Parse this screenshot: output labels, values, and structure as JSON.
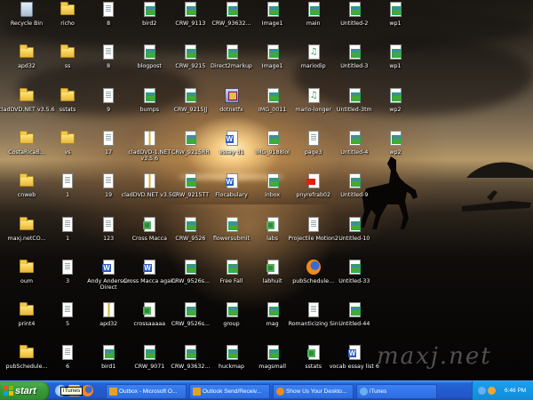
{
  "desktop": {
    "watermark": "maxj.net",
    "columns": [
      [
        {
          "label": "Recycle Bin",
          "icon": "recycle-bin-icon"
        },
        {
          "label": "apd32",
          "icon": "folder-icon"
        },
        {
          "label": "cladDVD.NET v3.5.6",
          "icon": "folder-icon"
        },
        {
          "label": "CostaRicaB...",
          "icon": "folder-icon"
        },
        {
          "label": "cnweb",
          "icon": "folder-icon"
        },
        {
          "label": "maxj.netCO...",
          "icon": "folder-icon"
        },
        {
          "label": "oum",
          "icon": "folder-icon"
        },
        {
          "label": "print4",
          "icon": "folder-icon"
        },
        {
          "label": "pubSchedule...",
          "icon": "folder-icon"
        }
      ],
      [
        {
          "label": "richo",
          "icon": "folder-icon"
        },
        {
          "label": "ss",
          "icon": "folder-icon"
        },
        {
          "label": "sstats",
          "icon": "folder-icon"
        },
        {
          "label": "vs",
          "icon": "folder-icon"
        },
        {
          "label": "1",
          "icon": "document-icon"
        },
        {
          "label": "1",
          "icon": "document-icon"
        },
        {
          "label": "3",
          "icon": "document-icon"
        },
        {
          "label": "5",
          "icon": "document-icon"
        },
        {
          "label": "6",
          "icon": "document-icon"
        }
      ],
      [
        {
          "label": "8",
          "icon": "document-icon"
        },
        {
          "label": "8",
          "icon": "document-icon"
        },
        {
          "label": "9",
          "icon": "document-icon"
        },
        {
          "label": "17",
          "icon": "document-icon"
        },
        {
          "label": "19",
          "icon": "document-icon"
        },
        {
          "label": "123",
          "icon": "document-icon"
        },
        {
          "label": "Andy Anderson Direct",
          "icon": "word-document-icon"
        },
        {
          "label": "apd32",
          "icon": "zip-archive-icon"
        },
        {
          "label": "bird1",
          "icon": "image-file-icon"
        }
      ],
      [
        {
          "label": "bird2",
          "icon": "image-file-icon"
        },
        {
          "label": "blogpost",
          "icon": "image-file-icon"
        },
        {
          "label": "bumps",
          "icon": "image-file-icon"
        },
        {
          "label": "cladDVD-1.NET v3.5.6",
          "icon": "zip-archive-icon"
        },
        {
          "label": "cladDVD.NET v3.5.6",
          "icon": "zip-archive-icon"
        },
        {
          "label": "Cross Macca",
          "icon": "excel-sheet-icon"
        },
        {
          "label": "Cross Macca again",
          "icon": "word-document-icon"
        },
        {
          "label": "crossaaaaa",
          "icon": "excel-sheet-icon"
        },
        {
          "label": "CRW_9071",
          "icon": "image-file-icon"
        }
      ],
      [
        {
          "label": "CRW_9113",
          "icon": "image-file-icon"
        },
        {
          "label": "CRW_9215",
          "icon": "image-file-icon"
        },
        {
          "label": "CRW_9215JJ",
          "icon": "image-file-icon"
        },
        {
          "label": "CRW_9215RR",
          "icon": "image-file-icon"
        },
        {
          "label": "CRW_9215TT",
          "icon": "image-file-icon"
        },
        {
          "label": "CRW_9526",
          "icon": "image-file-icon"
        },
        {
          "label": "CRW_9526s...",
          "icon": "image-file-icon"
        },
        {
          "label": "CRW_9526s...",
          "icon": "image-file-icon"
        },
        {
          "label": "CRW_93632...",
          "icon": "image-file-icon"
        }
      ],
      [
        {
          "label": "CRW_93632...",
          "icon": "image-file-icon"
        },
        {
          "label": "Direct2markup",
          "icon": "image-file-icon"
        },
        {
          "label": "dotnetfx",
          "icon": "installer-icon"
        },
        {
          "label": "essay d1",
          "icon": "word-document-icon"
        },
        {
          "label": "Flocabulary",
          "icon": "word-document-icon"
        },
        {
          "label": "flowersubmit",
          "icon": "image-file-icon"
        },
        {
          "label": "Free Fall",
          "icon": "image-file-icon"
        },
        {
          "label": "group",
          "icon": "image-file-icon"
        },
        {
          "label": "huckmap",
          "icon": "image-file-icon"
        }
      ],
      [
        {
          "label": "Image1",
          "icon": "image-file-icon"
        },
        {
          "label": "Image1",
          "icon": "image-file-icon"
        },
        {
          "label": "IMG_0011",
          "icon": "image-file-icon"
        },
        {
          "label": "IMG_9188lol",
          "icon": "image-file-icon"
        },
        {
          "label": "inbox",
          "icon": "image-file-icon"
        },
        {
          "label": "labs",
          "icon": "excel-sheet-icon"
        },
        {
          "label": "labhuit",
          "icon": "excel-sheet-icon"
        },
        {
          "label": "mag",
          "icon": "image-file-icon"
        },
        {
          "label": "magsmall",
          "icon": "image-file-icon"
        }
      ],
      [
        {
          "label": "main",
          "icon": "image-file-icon"
        },
        {
          "label": "mariodip",
          "icon": "audio-file-icon"
        },
        {
          "label": "mario-longer",
          "icon": "audio-file-icon"
        },
        {
          "label": "page3",
          "icon": "document-icon"
        },
        {
          "label": "pnyrefrab02",
          "icon": "pdf-file-icon"
        },
        {
          "label": "Projectile Motion2",
          "icon": "document-icon"
        },
        {
          "label": "pubSchedule...",
          "icon": "firefox-icon"
        },
        {
          "label": "Romanticizing Sin",
          "icon": "document-icon"
        },
        {
          "label": "sstats",
          "icon": "excel-sheet-icon"
        }
      ],
      [
        {
          "label": "Untitled-2",
          "icon": "image-file-icon"
        },
        {
          "label": "Untitled-3",
          "icon": "image-file-icon"
        },
        {
          "label": "Untitled-3tm",
          "icon": "image-file-icon"
        },
        {
          "label": "Untitled-4",
          "icon": "image-file-icon"
        },
        {
          "label": "Untitled-9",
          "icon": "image-file-icon"
        },
        {
          "label": "Untitled-10",
          "icon": "image-file-icon"
        },
        {
          "label": "Untitled-33",
          "icon": "image-file-icon"
        },
        {
          "label": "Untitled-44",
          "icon": "image-file-icon"
        },
        {
          "label": "vocab essay list 6",
          "icon": "word-document-icon"
        }
      ],
      [
        {
          "label": "wp1",
          "icon": "image-file-icon"
        },
        {
          "label": "wp1",
          "icon": "image-file-icon"
        },
        {
          "label": "wp2",
          "icon": "image-file-icon"
        },
        {
          "label": "wp2",
          "icon": "image-file-icon"
        }
      ]
    ]
  },
  "taskbar": {
    "start_label": "start",
    "tooltip": "iTunes",
    "buttons": [
      {
        "label": "Outbox - Microsoft O...",
        "icon": "outlook-icon",
        "color": "#e8a020"
      },
      {
        "label": "Outlook Send/Receiv...",
        "icon": "outlook-icon",
        "color": "#e8a020"
      },
      {
        "label": "Show Us Your Deskto...",
        "icon": "firefox-icon",
        "color": "#f08a1a"
      },
      {
        "label": "iTunes",
        "icon": "itunes-icon",
        "color": "#6ab0f0"
      }
    ],
    "clock": "6:46 PM"
  }
}
